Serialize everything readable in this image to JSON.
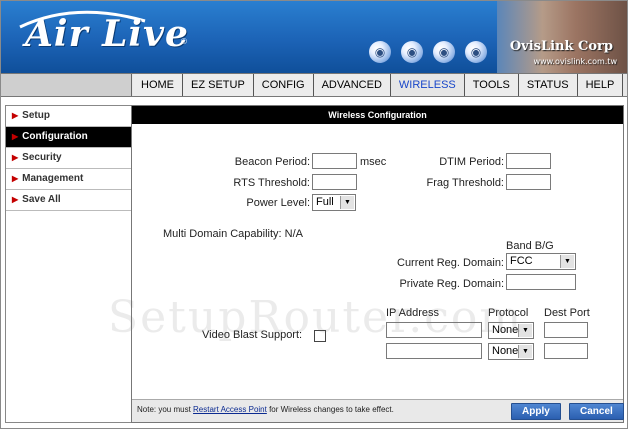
{
  "header": {
    "logo_text": "Air Live",
    "reg_mark": "®",
    "brand": "OvisLink Corp",
    "brand_url": "www.ovislink.com.tw"
  },
  "nav": {
    "tabs": [
      {
        "label": "HOME"
      },
      {
        "label": "EZ SETUP"
      },
      {
        "label": "CONFIG"
      },
      {
        "label": "ADVANCED"
      },
      {
        "label": "WIRELESS",
        "active": true
      },
      {
        "label": "TOOLS"
      },
      {
        "label": "STATUS"
      },
      {
        "label": "HELP"
      }
    ]
  },
  "sidebar": {
    "items": [
      {
        "label": "Setup"
      },
      {
        "label": "Configuration",
        "active": true
      },
      {
        "label": "Security"
      },
      {
        "label": "Management"
      },
      {
        "label": "Save All"
      }
    ]
  },
  "main": {
    "title": "Wireless Configuration",
    "beacon_label": "Beacon Period:",
    "beacon_value": "",
    "beacon_unit": "msec",
    "dtim_label": "DTIM Period:",
    "dtim_value": "",
    "rts_label": "RTS Threshold:",
    "rts_value": "",
    "frag_label": "Frag Threshold:",
    "frag_value": "",
    "power_label": "Power Level:",
    "power_value": "Full",
    "multi_domain": "Multi Domain Capability: N/A",
    "band_label": "Band B/G",
    "reg_domain_label": "Current Reg. Domain:",
    "reg_domain_value": "FCC",
    "private_reg_label": "Private Reg. Domain:",
    "private_reg_value": "",
    "ip_address_header": "IP Address",
    "protocol_header": "Protocol",
    "dest_port_header": "Dest Port",
    "video_blast_label": "Video Blast Support:",
    "rows": [
      {
        "ip": "",
        "protocol": "None",
        "port": ""
      },
      {
        "ip": "",
        "protocol": "None",
        "port": ""
      }
    ],
    "note_prefix": "Note: you must ",
    "note_link": "Restart Access Point",
    "note_suffix": " for Wireless changes to take effect.",
    "apply_label": "Apply",
    "cancel_label": "Cancel"
  },
  "watermark": "SetupRouter.com",
  "colors": {
    "accent": "#1c63b6",
    "active_tab": "#1846c9",
    "button": "#2b5fb0"
  }
}
